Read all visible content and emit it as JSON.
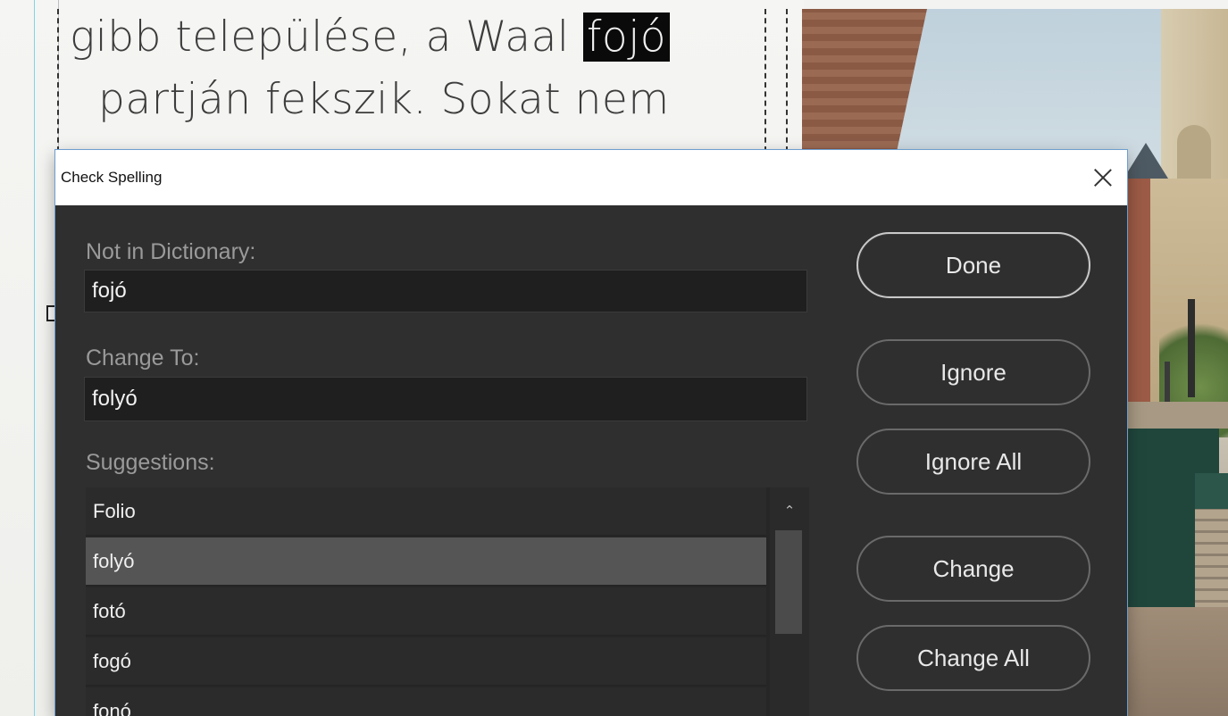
{
  "document": {
    "line1_prefix": "gibb települése, a Waal ",
    "line1_highlight": "fojó",
    "line2": "partján fekszik. Sokat nem"
  },
  "dialog": {
    "title": "Check Spelling",
    "not_in_dictionary_label": "Not in Dictionary:",
    "not_in_dictionary_value": "fojó",
    "change_to_label": "Change To:",
    "change_to_value": "folyó",
    "suggestions_label": "Suggestions:",
    "suggestions": [
      "Folio",
      "folyó",
      "fotó",
      "fogó",
      "fonó"
    ],
    "selected_suggestion": "folyó",
    "buttons": {
      "done": "Done",
      "ignore": "Ignore",
      "ignore_all": "Ignore All",
      "change": "Change",
      "change_all": "Change All"
    },
    "icons": {
      "close": "close-icon",
      "scroll_up": "chevron-up-icon"
    }
  },
  "colors": {
    "dialog_bg": "#2f2f2f",
    "field_bg": "#1f1f1f",
    "selected_row": "#555555",
    "highlight_bg": "#0a0a0a"
  }
}
